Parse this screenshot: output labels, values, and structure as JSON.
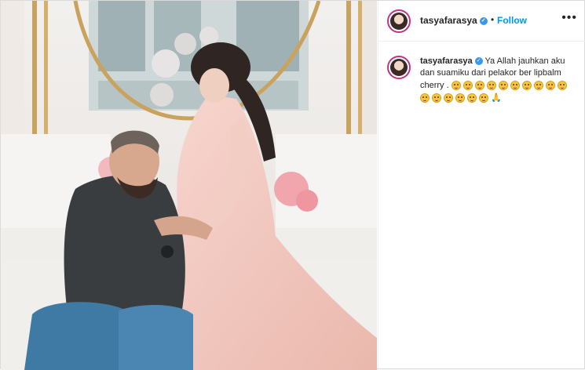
{
  "post": {
    "username": "tasyafarasya",
    "separator": "•",
    "follow_label": "Follow",
    "more_label": "•••"
  },
  "comment": {
    "username": "tasyafarasya",
    "text": "Ya Allah jauhkan aku dan suamiku dari pelakor ber lipbalm cherry .",
    "emoji_count": 16,
    "trailing_emoji": "🙏"
  },
  "colors": {
    "follow_blue": "#0095f6",
    "verified_blue": "#3897f0",
    "story_ring": "#c13584"
  }
}
